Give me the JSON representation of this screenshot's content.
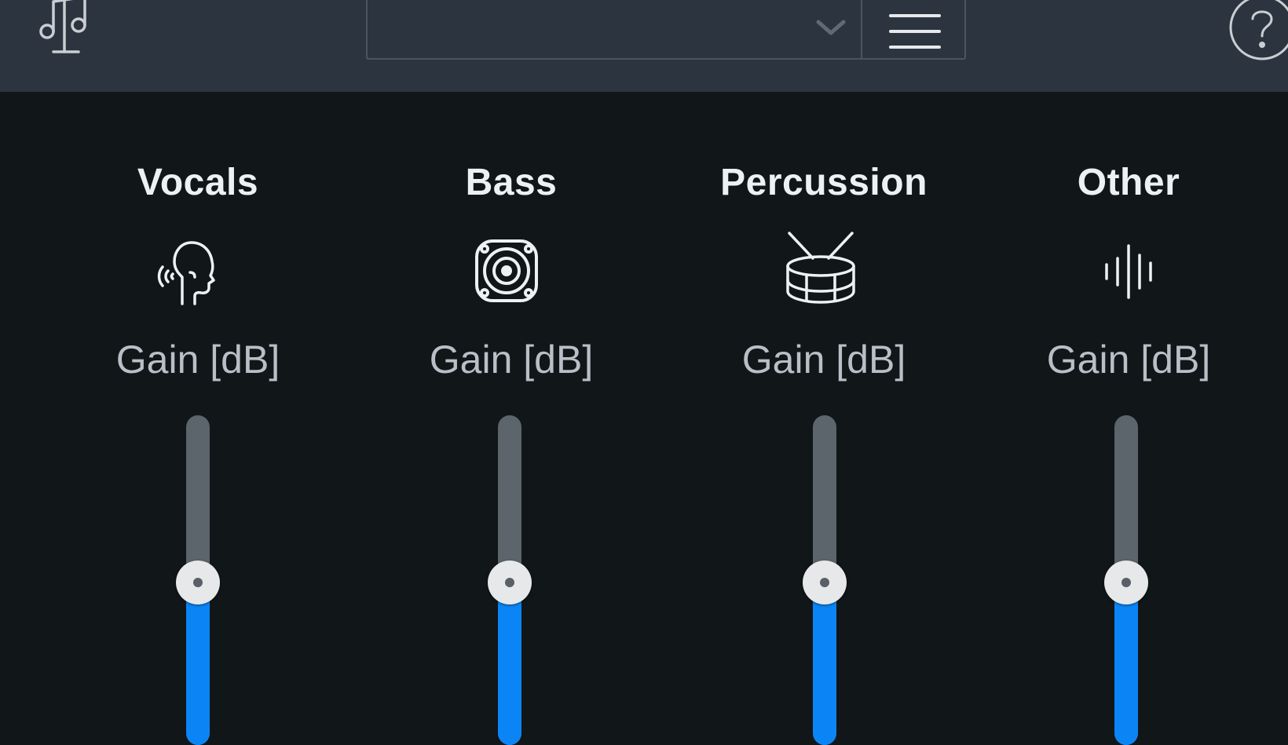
{
  "header": {
    "logo_icon": "music-stand-icon",
    "preset_value": "",
    "preset_dropdown_icon": "chevron-down-icon",
    "menu_icon": "hamburger-menu-icon",
    "help_icon": "question-mark-icon"
  },
  "channels": [
    {
      "name": "Vocals",
      "icon": "singing-head-icon",
      "gain_label": "Gain [dB]",
      "level_fraction": 0.48
    },
    {
      "name": "Bass",
      "icon": "speaker-icon",
      "gain_label": "Gain [dB]",
      "level_fraction": 0.48
    },
    {
      "name": "Percussion",
      "icon": "drum-icon",
      "gain_label": "Gain [dB]",
      "level_fraction": 0.48
    },
    {
      "name": "Other",
      "icon": "waveform-icon",
      "gain_label": "Gain [dB]",
      "level_fraction": 0.48
    }
  ],
  "colors": {
    "topbar": "#2c353f",
    "background": "#111619",
    "slider_fill": "#0b85f5",
    "slider_track": "#5c646c"
  }
}
